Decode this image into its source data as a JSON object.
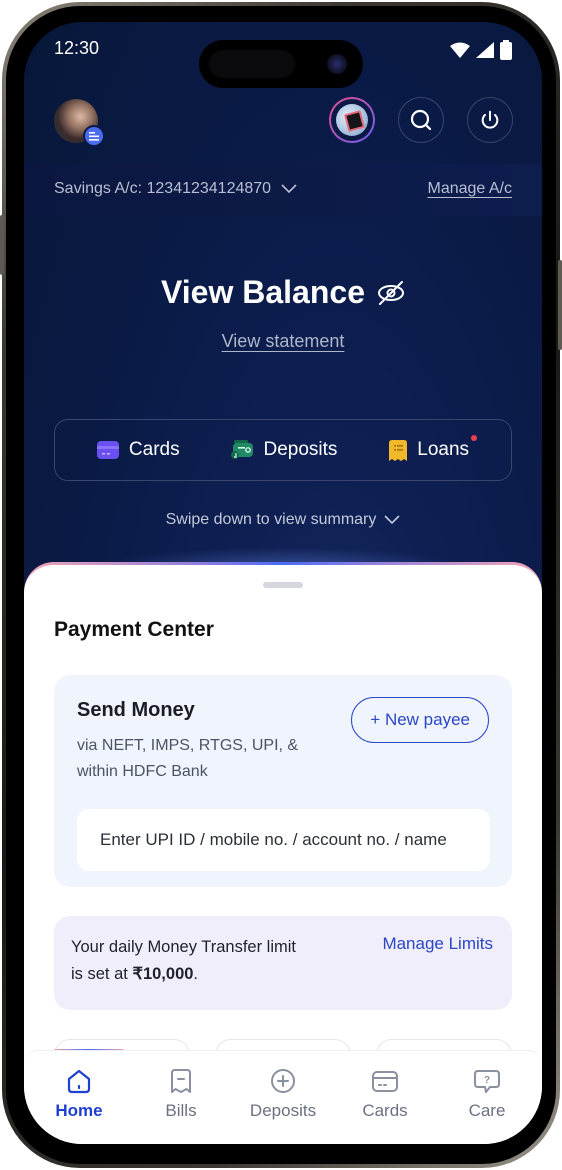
{
  "status_bar": {
    "time": "12:30",
    "icons": [
      "wifi-icon",
      "signal-icon",
      "battery-icon"
    ]
  },
  "header": {
    "avatar_icon": "user-avatar",
    "avatar_badge_icon": "menu-icon",
    "actions": [
      {
        "name": "promo-button",
        "icon": "gift-card-icon"
      },
      {
        "name": "search-button",
        "icon": "search-icon"
      },
      {
        "name": "logout-button",
        "icon": "power-icon"
      }
    ]
  },
  "account": {
    "label": "Savings A/c: 12341234124870",
    "manage_label": "Manage A/c"
  },
  "balance": {
    "title": "View Balance",
    "visibility_icon": "eye-off-icon",
    "statement_link": "View statement"
  },
  "quick_links": [
    {
      "label": "Cards",
      "icon": "card-icon",
      "color": "#6a50f0",
      "notification": false
    },
    {
      "label": "Deposits",
      "icon": "wallet-icon",
      "color": "#1f8a64",
      "notification": false
    },
    {
      "label": "Loans",
      "icon": "receipt-icon",
      "color": "#f0b82a",
      "notification": true
    }
  ],
  "swipe_hint": "Swipe down to view summary",
  "payment_center": {
    "title": "Payment Center",
    "send_money": {
      "title": "Send Money",
      "subtitle": "via NEFT, IMPS, RTGS, UPI, & within HDFC Bank",
      "new_payee_label": "+ New payee",
      "input_placeholder": "Enter UPI ID / mobile no. / account no. / name",
      "input_value": ""
    },
    "limit": {
      "text_prefix": "Your daily Money Transfer limit is set at ",
      "amount": "₹10,000",
      "text_suffix": ".",
      "manage_label": "Manage Limits"
    }
  },
  "bottom_nav": [
    {
      "label": "Home",
      "icon": "home-icon",
      "active": true
    },
    {
      "label": "Bills",
      "icon": "bill-icon",
      "active": false
    },
    {
      "label": "Deposits",
      "icon": "plus-circle-icon",
      "active": false
    },
    {
      "label": "Cards",
      "icon": "card-icon",
      "active": false
    },
    {
      "label": "Care",
      "icon": "help-chat-icon",
      "active": false
    }
  ],
  "colors": {
    "brand_blue": "#2a46c4",
    "header_bg": "#0b1a45",
    "send_card_bg": "#f0f4fd",
    "limit_card_bg": "#f1eefc",
    "notification_red": "#e8434f"
  }
}
